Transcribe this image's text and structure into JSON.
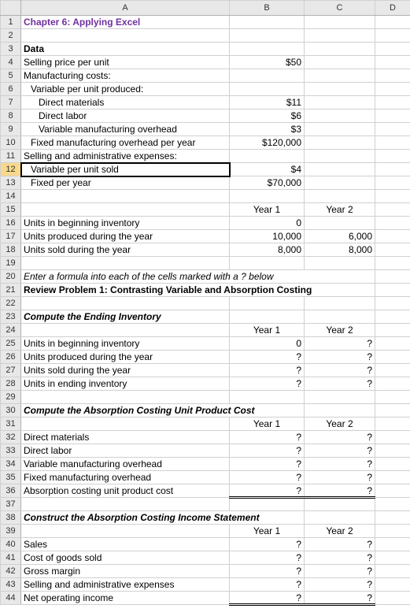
{
  "columns": {
    "rowhdr": "",
    "A": "A",
    "B": "B",
    "C": "C",
    "D": "D"
  },
  "selected_row": 12,
  "rows": {
    "1": {
      "A": "Chapter 6: Applying Excel"
    },
    "2": {},
    "3": {
      "A": "Data"
    },
    "4": {
      "A": "Selling price per unit",
      "B": "$50"
    },
    "5": {
      "A": "Manufacturing costs:"
    },
    "6": {
      "A": "Variable per unit produced:"
    },
    "7": {
      "A": "Direct materials",
      "B": "$11"
    },
    "8": {
      "A": "Direct labor",
      "B": "$6"
    },
    "9": {
      "A": "Variable manufacturing overhead",
      "B": "$3"
    },
    "10": {
      "A": "Fixed manufacturing overhead per year",
      "B": "$120,000"
    },
    "11": {
      "A": "Selling and administrative expenses:"
    },
    "12": {
      "A": "Variable per unit sold",
      "B": "$4"
    },
    "13": {
      "A": "Fixed per year",
      "B": "$70,000"
    },
    "14": {},
    "15": {
      "B": "Year 1",
      "C": "Year 2"
    },
    "16": {
      "A": "Units in beginning inventory",
      "B": "0"
    },
    "17": {
      "A": "Units produced during the year",
      "B": "10,000",
      "C": "6,000"
    },
    "18": {
      "A": "Units sold during the year",
      "B": "8,000",
      "C": "8,000"
    },
    "19": {},
    "20": {
      "A": "Enter a formula into each of the cells marked with a ? below"
    },
    "21": {
      "A": "Review Problem 1: Contrasting Variable and Absorption Costing"
    },
    "22": {},
    "23": {
      "A": "Compute the Ending Inventory"
    },
    "24": {
      "B": "Year 1",
      "C": "Year 2"
    },
    "25": {
      "A": "Units in beginning inventory",
      "B": "0",
      "C": "?"
    },
    "26": {
      "A": "Units produced during the year",
      "B": "?",
      "C": "?"
    },
    "27": {
      "A": "Units sold during the year",
      "B": "?",
      "C": "?"
    },
    "28": {
      "A": "Units in ending inventory",
      "B": "?",
      "C": "?"
    },
    "29": {},
    "30": {
      "A": "Compute the Absorption Costing Unit Product Cost"
    },
    "31": {
      "B": "Year 1",
      "C": "Year 2"
    },
    "32": {
      "A": "Direct materials",
      "B": "?",
      "C": "?"
    },
    "33": {
      "A": "Direct labor",
      "B": "?",
      "C": "?"
    },
    "34": {
      "A": "Variable manufacturing overhead",
      "B": "?",
      "C": "?"
    },
    "35": {
      "A": "Fixed manufacturing overhead",
      "B": "?",
      "C": "?"
    },
    "36": {
      "A": "Absorption costing unit product cost",
      "B": "?",
      "C": "?"
    },
    "37": {},
    "38": {
      "A": "Construct the Absorption Costing Income Statement"
    },
    "39": {
      "B": "Year 1",
      "C": "Year 2"
    },
    "40": {
      "A": "Sales",
      "B": "?",
      "C": "?"
    },
    "41": {
      "A": "Cost of goods sold",
      "B": "?",
      "C": "?"
    },
    "42": {
      "A": "Gross margin",
      "B": "?",
      "C": "?"
    },
    "43": {
      "A": "Selling and administrative expenses",
      "B": "?",
      "C": "?"
    },
    "44": {
      "A": "Net operating income",
      "B": "?",
      "C": "?"
    }
  }
}
